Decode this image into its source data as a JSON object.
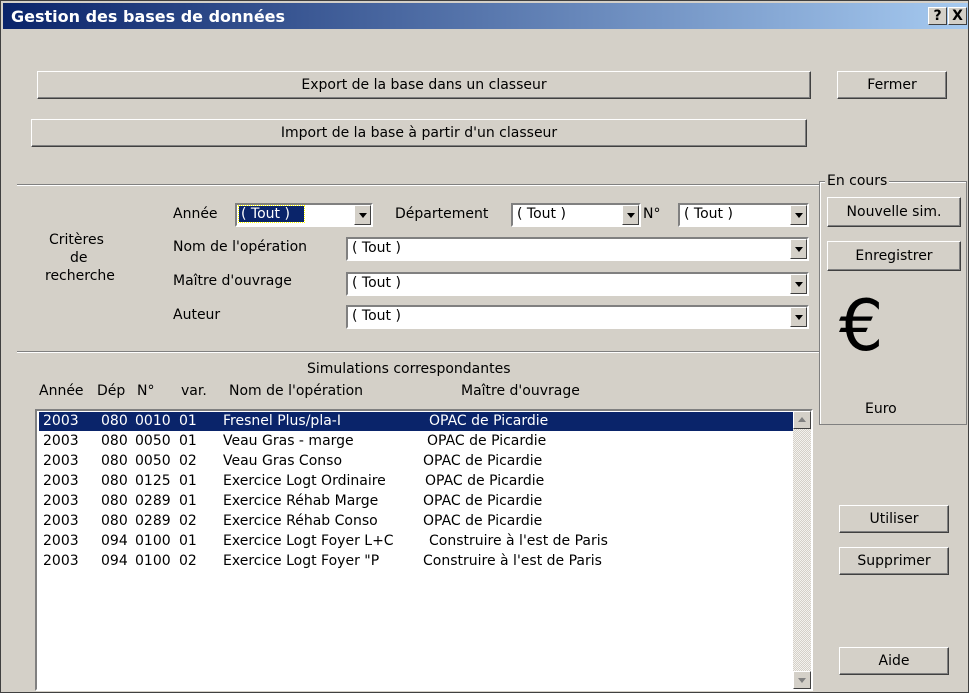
{
  "window": {
    "title": "Gestion des bases de données",
    "help_button": "?",
    "close_button": "X"
  },
  "buttons": {
    "export": "Export de la base dans un classeur",
    "import": "Import de la base à partir d'un classeur",
    "fermer": "Fermer",
    "nouvelle_sim": "Nouvelle sim.",
    "enregistrer": "Enregistrer",
    "utiliser": "Utiliser",
    "supprimer": "Supprimer",
    "aide": "Aide"
  },
  "criteria": {
    "section_label": [
      "Critères",
      "de",
      "recherche"
    ],
    "annee_label": "Année",
    "annee_value": "( Tout )",
    "departement_label": "Département",
    "departement_value": "( Tout )",
    "numero_label": "N°",
    "numero_value": "( Tout )",
    "nom_operation_label": "Nom de l'opération",
    "nom_operation_value": "( Tout )",
    "maitre_ouvrage_label": "Maître d'ouvrage",
    "maitre_ouvrage_value": "( Tout )",
    "auteur_label": "Auteur",
    "auteur_value": "( Tout )"
  },
  "en_cours": {
    "title": "En cours",
    "euro_symbol": "€",
    "euro_label": "Euro"
  },
  "results": {
    "title": "Simulations correspondantes",
    "columns": [
      "Année",
      "Dép",
      "N°",
      "var.",
      "Nom de l'opération",
      "Maître d'ouvrage"
    ],
    "rows": [
      {
        "annee": "2003",
        "dep": "080",
        "num": "0010",
        "var": "01",
        "nom": "Fresnel Plus/pla-I",
        "maitre": "OPAC de Picardie",
        "selected": true
      },
      {
        "annee": "2003",
        "dep": "080",
        "num": "0050",
        "var": "01",
        "nom": "Veau Gras - marge",
        "maitre": "OPAC de Picardie"
      },
      {
        "annee": "2003",
        "dep": "080",
        "num": "0050",
        "var": "02",
        "nom": "Veau Gras Conso",
        "maitre": "OPAC de Picardie"
      },
      {
        "annee": "2003",
        "dep": "080",
        "num": "0125",
        "var": "01",
        "nom": "Exercice Logt Ordinaire",
        "maitre": "OPAC de Picardie"
      },
      {
        "annee": "2003",
        "dep": "080",
        "num": "0289",
        "var": "01",
        "nom": "Exercice Réhab Marge",
        "maitre": "OPAC de Picardie"
      },
      {
        "annee": "2003",
        "dep": "080",
        "num": "0289",
        "var": "02",
        "nom": "Exercice Réhab Conso",
        "maitre": "OPAC de Picardie"
      },
      {
        "annee": "2003",
        "dep": "094",
        "num": "0100",
        "var": "01",
        "nom": "Exercice Logt Foyer L+C",
        "maitre": "Construire à l'est de Paris"
      },
      {
        "annee": "2003",
        "dep": "094",
        "num": "0100",
        "var": "02",
        "nom": "Exercice Logt Foyer \"P",
        "maitre": "Construire à l'est de Paris"
      }
    ]
  },
  "colors": {
    "title_gradient_start": "#0a246a",
    "title_gradient_end": "#a6caf0",
    "dialog_face": "#d4d0c8",
    "selection": "#0a246a"
  }
}
